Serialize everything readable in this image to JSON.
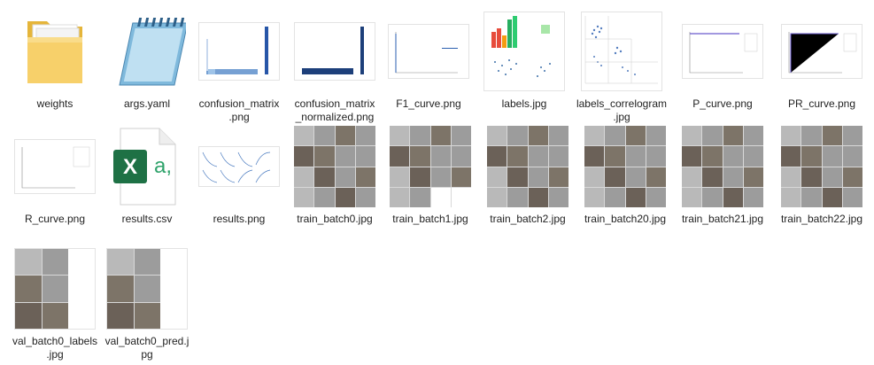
{
  "files": [
    {
      "name": "weights",
      "icon": "folder-icon"
    },
    {
      "name": "args.yaml",
      "icon": "notepad-icon"
    },
    {
      "name": "confusion_matrix\n.png",
      "icon": "image-thumbnail"
    },
    {
      "name": "confusion_matrix\n_normalized.png",
      "icon": "image-thumbnail"
    },
    {
      "name": "F1_curve.png",
      "icon": "image-thumbnail"
    },
    {
      "name": "labels.jpg",
      "icon": "image-thumbnail"
    },
    {
      "name": "labels_correlogram\n.jpg",
      "icon": "image-thumbnail"
    },
    {
      "name": "P_curve.png",
      "icon": "image-thumbnail"
    },
    {
      "name": "PR_curve.png",
      "icon": "image-thumbnail"
    },
    {
      "name": "R_curve.png",
      "icon": "image-thumbnail"
    },
    {
      "name": "results.csv",
      "icon": "excel-csv-icon"
    },
    {
      "name": "results.png",
      "icon": "image-thumbnail"
    },
    {
      "name": "train_batch0.jpg",
      "icon": "image-thumbnail"
    },
    {
      "name": "train_batch1.jpg",
      "icon": "image-thumbnail"
    },
    {
      "name": "train_batch2.jpg",
      "icon": "image-thumbnail"
    },
    {
      "name": "train_batch20.jpg",
      "icon": "image-thumbnail"
    },
    {
      "name": "train_batch21.jpg",
      "icon": "image-thumbnail"
    },
    {
      "name": "train_batch22.jpg",
      "icon": "image-thumbnail"
    },
    {
      "name": "val_batch0_labels\n.jpg",
      "icon": "image-thumbnail"
    },
    {
      "name": "val_batch0_pred.j\npg",
      "icon": "image-thumbnail"
    }
  ],
  "colors": {
    "folder": "#f5c94a",
    "excel": "#1e7145",
    "plot_line": "#2b5fb0"
  }
}
